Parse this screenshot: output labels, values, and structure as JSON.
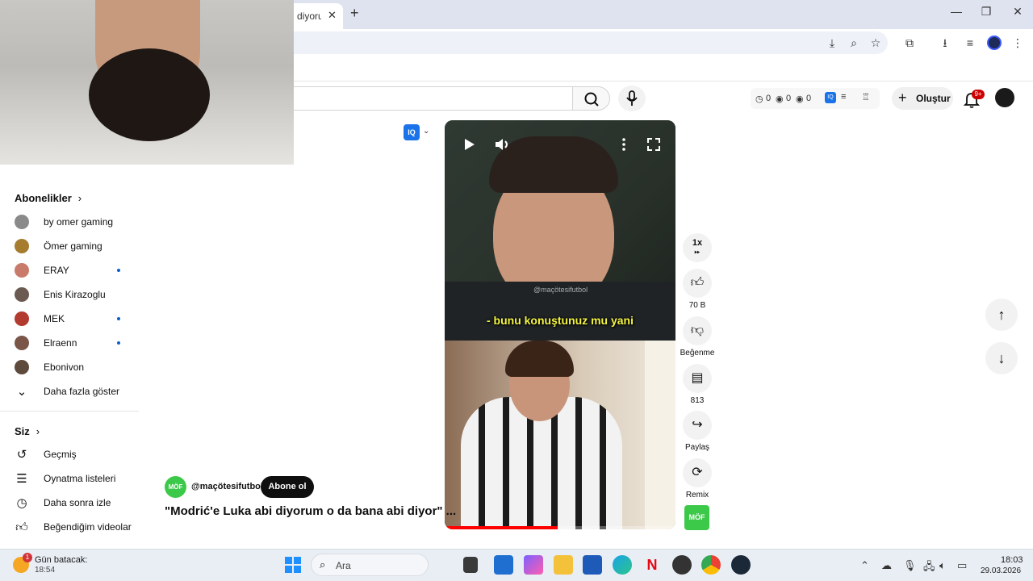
{
  "browser": {
    "tab_title": "diyoru",
    "tab_close": "✕",
    "new_tab": "+",
    "window_minimize": "—",
    "window_maximize": "❐",
    "window_close": "✕"
  },
  "header": {
    "stats": {
      "watch": "0",
      "views": "0",
      "other": "0"
    },
    "create_label": "Oluştur",
    "notifications_badge": "9+"
  },
  "sidebar": {
    "subscriptions_title": "Abonelikler",
    "subscriptions": [
      {
        "name": "by omer gaming",
        "color": "#8a8a8a",
        "new": false
      },
      {
        "name": "Ömer gaming",
        "color": "#a67c2e",
        "new": false
      },
      {
        "name": "ERAY",
        "color": "#c97b6b",
        "new": true
      },
      {
        "name": "Enis Kirazoglu",
        "color": "#6b5a52",
        "new": false
      },
      {
        "name": "MEK",
        "color": "#b23a2f",
        "new": true
      },
      {
        "name": "Elraenn",
        "color": "#7a5548",
        "new": true
      },
      {
        "name": "Ebonivon",
        "color": "#5e4a3c",
        "new": false
      }
    ],
    "show_more": "Daha fazla göster",
    "you_title": "Siz",
    "you_items": [
      {
        "label": "Geçmiş",
        "icon": "history-icon"
      },
      {
        "label": "Oynatma listeleri",
        "icon": "playlist-icon"
      },
      {
        "label": "Daha sonra izle",
        "icon": "clock-icon"
      },
      {
        "label": "Beğendiğim videolar",
        "icon": "like-icon"
      }
    ]
  },
  "video": {
    "iq_label": "IQ",
    "watermark": "@maçötesifutbol",
    "subtitle": "- bunu konuştunuz mu yani",
    "progress": 0.49,
    "channel_handle": "@maçötesifutbol",
    "channel_logo": "MÖF",
    "subscribe_label": "Abone ol",
    "title": "\"Modrić'e Luka abi diyorum o da bana abi diyor\" ..."
  },
  "actions": {
    "speed": "1x",
    "likes": "70 B",
    "dislike_label": "Beğenme",
    "comments": "813",
    "share_label": "Paylaş",
    "remix_label": "Remix"
  },
  "taskbar": {
    "weather_badge": "1",
    "weather_title": "Gün batacak:",
    "weather_time": "18:54",
    "search_label": "Ara",
    "clock_time": "18:03",
    "clock_date": "29.03.2026"
  }
}
